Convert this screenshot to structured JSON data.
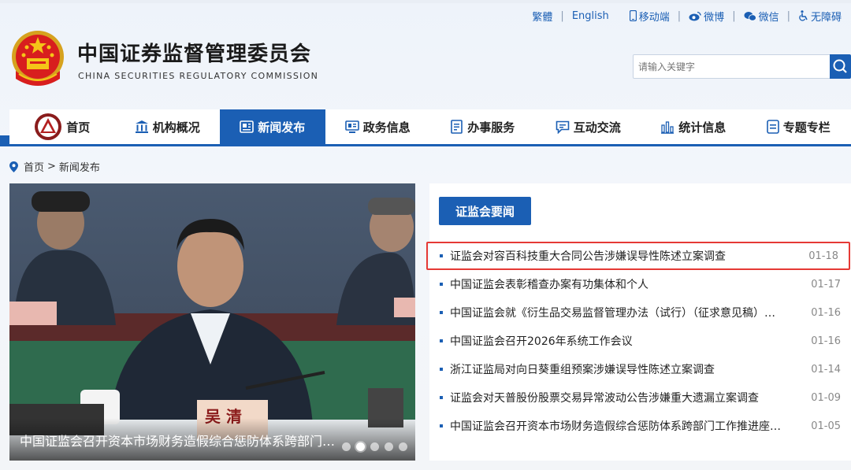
{
  "toplinks": {
    "traditional": "繁體",
    "english": "English",
    "mobile": "移动端",
    "weibo": "微博",
    "wechat": "微信",
    "accessible": "无障碍"
  },
  "header": {
    "title_cn": "中国证券监督管理委员会",
    "title_en": "CHINA SECURITIES REGULATORY COMMISSION"
  },
  "search": {
    "placeholder": "请输入关键字"
  },
  "nav": {
    "items": [
      {
        "label": "首页",
        "icon": "emblem-icon"
      },
      {
        "label": "机构概况",
        "icon": "building-icon"
      },
      {
        "label": "新闻发布",
        "icon": "news-icon"
      },
      {
        "label": "政务信息",
        "icon": "monitor-icon"
      },
      {
        "label": "办事服务",
        "icon": "document-icon"
      },
      {
        "label": "互动交流",
        "icon": "chat-icon"
      },
      {
        "label": "统计信息",
        "icon": "bar-chart-icon"
      },
      {
        "label": "专题专栏",
        "icon": "list-icon"
      }
    ],
    "active_index": 2
  },
  "breadcrumb": {
    "home": "首页",
    "separator": ">",
    "current": "新闻发布"
  },
  "carousel": {
    "caption": "中国证监会召开资本市场财务造假综合惩防体系跨部门…",
    "nameplate": "吴 清",
    "dot_count": 5,
    "active_dot": 1
  },
  "panel": {
    "tab_label": "证监会要闻",
    "news": [
      {
        "title": "证监会对容百科技重大合同公告涉嫌误导性陈述立案调查",
        "date": "01-18",
        "highlight": true
      },
      {
        "title": "中国证监会表彰稽查办案有功集体和个人",
        "date": "01-17"
      },
      {
        "title": "中国证监会就《衍生品交易监督管理办法（试行）（征求意见稿）…",
        "date": "01-16"
      },
      {
        "title": "中国证监会召开2026年系统工作会议",
        "date": "01-16"
      },
      {
        "title": "浙江证监局对向日葵重组预案涉嫌误导性陈述立案调查",
        "date": "01-14"
      },
      {
        "title": "证监会对天普股份股票交易异常波动公告涉嫌重大遗漏立案调查",
        "date": "01-09"
      },
      {
        "title": "中国证监会召开资本市场财务造假综合惩防体系跨部门工作推进座…",
        "date": "01-05"
      }
    ]
  },
  "colors": {
    "brand_blue": "#1b5fb4",
    "highlight_red": "#e53935"
  }
}
